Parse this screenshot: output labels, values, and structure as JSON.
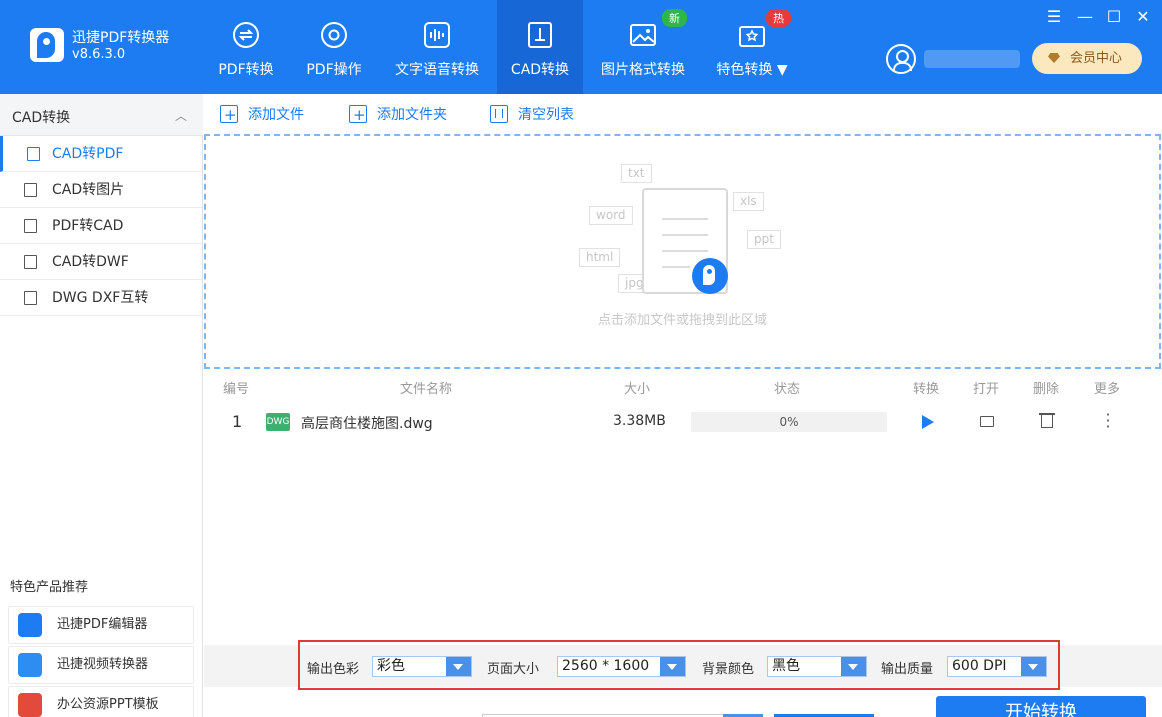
{
  "app": {
    "name": "迅捷PDF转换器",
    "version": "v8.6.3.0"
  },
  "nav": [
    {
      "label": "PDF转换",
      "icon": "pdf-convert-icon"
    },
    {
      "label": "PDF操作",
      "icon": "pdf-operation-icon"
    },
    {
      "label": "文字语音转换",
      "icon": "audio-wave-icon"
    },
    {
      "label": "CAD转换",
      "icon": "cad-icon",
      "active": true
    },
    {
      "label": "图片格式转换",
      "icon": "image-icon",
      "badge": "新"
    },
    {
      "label": "特色转换 ▼",
      "icon": "special-icon",
      "badge": "热"
    }
  ],
  "vip_label": "会员中心",
  "sidebar": {
    "header": "CAD转换",
    "items": [
      {
        "label": "CAD转PDF"
      },
      {
        "label": "CAD转图片"
      },
      {
        "label": "PDF转CAD"
      },
      {
        "label": "CAD转DWF"
      },
      {
        "label": "DWG DXF互转"
      }
    ],
    "recommend_title": "特色产品推荐",
    "recommend": [
      {
        "label": "迅捷PDF编辑器"
      },
      {
        "label": "迅捷视频转换器"
      },
      {
        "label": "办公资源PPT模板"
      }
    ]
  },
  "toolbar": {
    "add_file": "添加文件",
    "add_folder": "添加文件夹",
    "clear_list": "清空列表"
  },
  "dropzone": {
    "hint": "点击添加文件或拖拽到此区域",
    "tags": [
      "txt",
      "word",
      "xls",
      "ppt",
      "html",
      "jpg"
    ]
  },
  "table": {
    "headers": [
      "编号",
      "文件名称",
      "大小",
      "状态",
      "转换",
      "打开",
      "删除",
      "更多"
    ],
    "rows": [
      {
        "index": "1",
        "type": "DWG",
        "name": "高层商住楼施图.dwg",
        "size": "3.38MB",
        "status": "0%",
        "progress": 0
      }
    ]
  },
  "settings": {
    "color_label": "输出色彩",
    "color_value": "彩色",
    "page_label": "页面大小",
    "page_value": "2560 * 1600",
    "bg_label": "背景颜色",
    "bg_value": "黑色",
    "quality_label": "输出质量",
    "quality_value": "600 DPI"
  },
  "start_button": "开始转换",
  "colors": {
    "primary": "#1e7cf2",
    "highlight_border": "#e53935",
    "badge_new": "#2fb64a",
    "badge_hot": "#e83a3a"
  }
}
